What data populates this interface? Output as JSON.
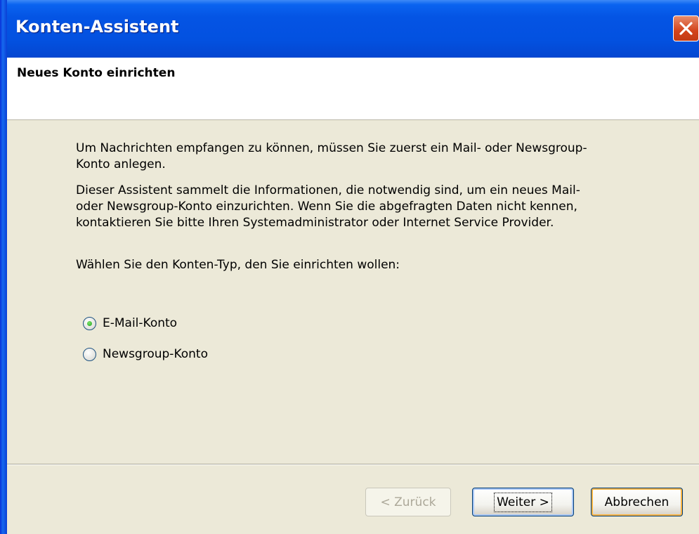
{
  "window": {
    "title": "Konten-Assistent",
    "close_icon": "close-icon"
  },
  "header": {
    "title": "Neues Konto einrichten"
  },
  "body": {
    "paragraph1": "Um Nachrichten empfangen zu können, müssen Sie zuerst ein Mail- oder Newsgroup-Konto anlegen.",
    "paragraph2": "Dieser Assistent sammelt die Informationen, die notwendig sind, um ein neues Mail- oder Newsgroup-Konto einzurichten. Wenn Sie die abgefragten Daten nicht kennen, kontaktieren Sie bitte Ihren Systemadministrator oder Internet Service Provider.",
    "prompt": "Wählen Sie den Konten-Typ, den Sie einrichten wollen:"
  },
  "account_types": {
    "selected": "E-Mail-Konto",
    "options": [
      "E-Mail-Konto",
      "Newsgroup-Konto"
    ]
  },
  "buttons": {
    "back": "< Zurück",
    "next": "Weiter >",
    "cancel": "Abbrechen"
  },
  "colors": {
    "titlebar": "#0454E4",
    "dialog_bg": "#ECE9D8",
    "close_button": "#D3431B",
    "radio_dot": "#21A121"
  }
}
